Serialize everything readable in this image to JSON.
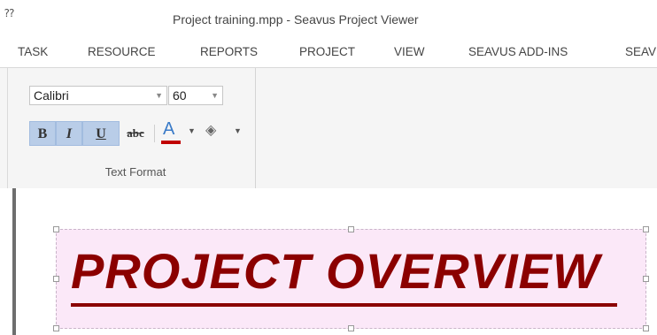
{
  "window": {
    "title": "Project training.mpp - Seavus Project Viewer",
    "qat_icon": "quick-access-toolbar-icon"
  },
  "tabs": [
    {
      "label": "TASK"
    },
    {
      "label": "RESOURCE"
    },
    {
      "label": "REPORTS"
    },
    {
      "label": "PROJECT"
    },
    {
      "label": "VIEW"
    },
    {
      "label": "SEAVUS ADD-INS"
    },
    {
      "label": "SEAV"
    }
  ],
  "ribbon": {
    "text_format": {
      "font_name": "Calibri",
      "font_size": "60",
      "bold_label": "B",
      "italic_label": "I",
      "underline_label": "U",
      "strikethrough_label": "abc",
      "font_color_label": "A",
      "font_color": "#c00000",
      "group_label": "Text Format"
    }
  },
  "document": {
    "heading": "PROJECT OVERVIEW",
    "heading_color": "#8b0000",
    "textbox_fill": "#fbe8f8"
  }
}
